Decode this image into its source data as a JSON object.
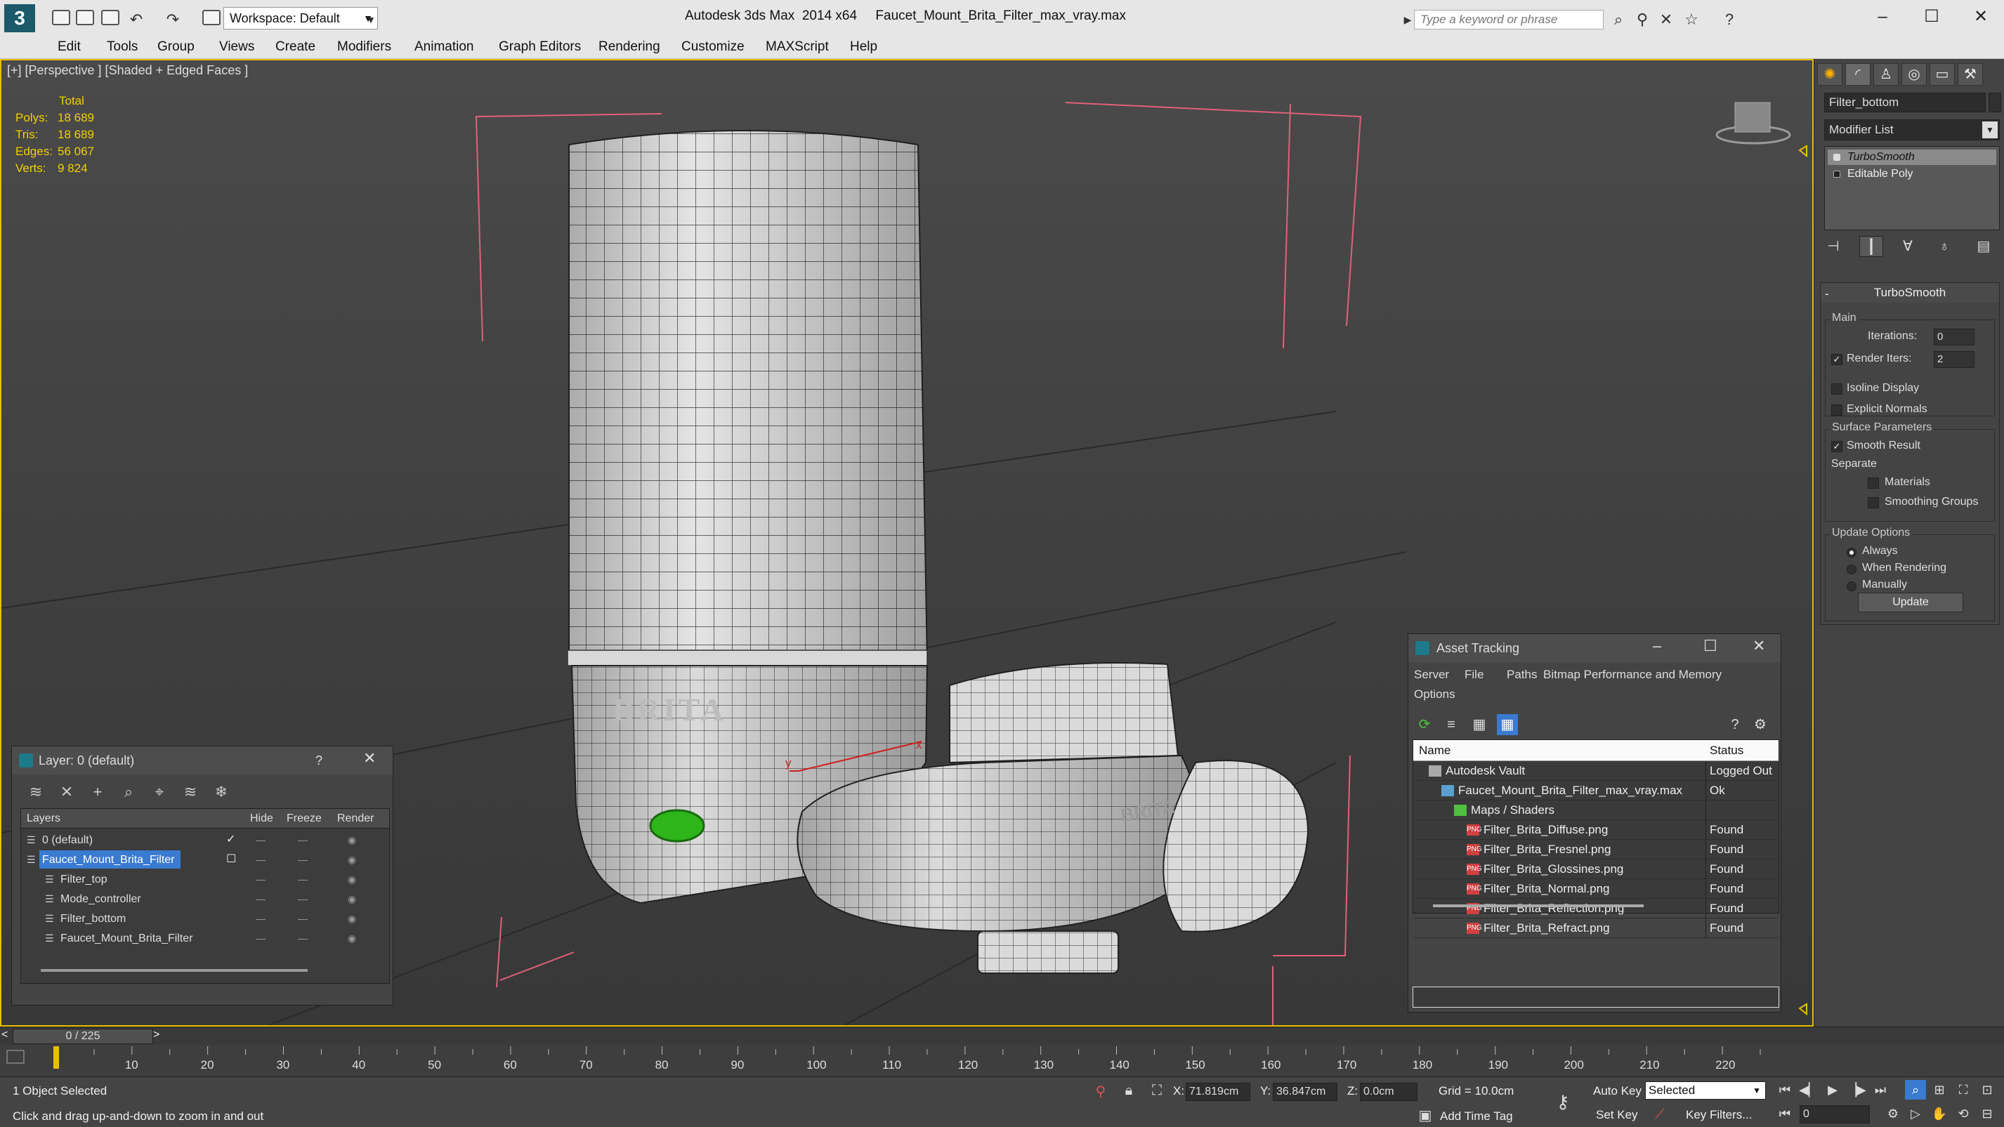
{
  "app": {
    "title": "Autodesk 3ds Max  2014 x64     Faucet_Mount_Brita_Filter_max_vray.max",
    "logo_glyph": "3",
    "workspace": "Workspace: Default",
    "search_placeholder": "Type a keyword or phrase"
  },
  "menu": [
    "Edit",
    "Tools",
    "Group",
    "Views",
    "Create",
    "Modifiers",
    "Animation",
    "Graph Editors",
    "Rendering",
    "Customize",
    "MAXScript",
    "Help"
  ],
  "viewport": {
    "label": "[+] [Perspective ] [Shaded + Edged Faces ]",
    "stats": {
      "heading": "Total",
      "rows": [
        {
          "label": "Polys:",
          "value": "18 689"
        },
        {
          "label": "Tris:",
          "value": "18 689"
        },
        {
          "label": "Edges:",
          "value": "56 067"
        },
        {
          "label": "Verts:",
          "value": "9 824"
        }
      ]
    },
    "brand_text": "BRITA",
    "accent": "#e8c000"
  },
  "command_panel": {
    "object_name": "Filter_bottom",
    "modifier_list": "Modifier List",
    "stack": [
      "TurboSmooth",
      "Editable Poly"
    ],
    "rollout": {
      "title": "TurboSmooth",
      "main_group": "Main",
      "iterations_label": "Iterations:",
      "iterations_value": "0",
      "render_iters_label": "Render Iters:",
      "render_iters_value": "2",
      "isoline": "Isoline Display",
      "explicit": "Explicit Normals",
      "surface_group": "Surface Parameters",
      "smooth_result": "Smooth Result",
      "separate": "Separate",
      "materials": "Materials",
      "smoothing_groups": "Smoothing Groups",
      "update_group": "Update Options",
      "always": "Always",
      "when_rendering": "When Rendering",
      "manually": "Manually",
      "update_btn": "Update"
    }
  },
  "layer_dialog": {
    "title": "Layer: 0 (default)",
    "help": "?",
    "columns": [
      "Layers",
      "Hide",
      "Freeze",
      "Render"
    ],
    "rows": [
      {
        "name": "0 (default)",
        "indent": 0,
        "active": true,
        "selected": false
      },
      {
        "name": "Faucet_Mount_Brita_Filter",
        "indent": 0,
        "active": false,
        "selected": true
      },
      {
        "name": "Filter_top",
        "indent": 1,
        "active": false,
        "selected": false
      },
      {
        "name": "Mode_controller",
        "indent": 1,
        "active": false,
        "selected": false
      },
      {
        "name": "Filter_bottom",
        "indent": 1,
        "active": false,
        "selected": false
      },
      {
        "name": "Faucet_Mount_Brita_Filter",
        "indent": 1,
        "active": false,
        "selected": false
      }
    ]
  },
  "asset_dialog": {
    "title": "Asset Tracking",
    "menu": [
      "Server",
      "File",
      "Paths",
      "Bitmap Performance and Memory"
    ],
    "menu2": "Options",
    "columns": [
      "Name",
      "Status"
    ],
    "rows": [
      {
        "name": "Autodesk Vault",
        "status": "Logged Out",
        "indent": 1,
        "icon": "vault-icon"
      },
      {
        "name": "Faucet_Mount_Brita_Filter_max_vray.max",
        "status": "Ok",
        "indent": 2,
        "icon": "max-file-icon"
      },
      {
        "name": "Maps / Shaders",
        "status": "",
        "indent": 3,
        "icon": "folder-icon"
      },
      {
        "name": "Filter_Brita_Diffuse.png",
        "status": "Found",
        "indent": 4,
        "icon": "png-icon"
      },
      {
        "name": "Filter_Brita_Fresnel.png",
        "status": "Found",
        "indent": 4,
        "icon": "png-icon"
      },
      {
        "name": "Filter_Brita_Glossines.png",
        "status": "Found",
        "indent": 4,
        "icon": "png-icon"
      },
      {
        "name": "Filter_Brita_Normal.png",
        "status": "Found",
        "indent": 4,
        "icon": "png-icon"
      },
      {
        "name": "Filter_Brita_Reflection.png",
        "status": "Found",
        "indent": 4,
        "icon": "png-icon"
      },
      {
        "name": "Filter_Brita_Refract.png",
        "status": "Found",
        "indent": 4,
        "icon": "png-icon"
      }
    ]
  },
  "timeline": {
    "frame": "0 / 225",
    "ticks": [
      0,
      10,
      20,
      30,
      40,
      50,
      60,
      70,
      80,
      90,
      100,
      110,
      120,
      130,
      140,
      150,
      160,
      170,
      180,
      190,
      200,
      210,
      220
    ],
    "max_frame": 225
  },
  "status": {
    "selected": "1 Object Selected",
    "prompt": "Click and drag up-and-down to zoom in and out",
    "x_label": "X:",
    "x": "71.819cm",
    "y_label": "Y:",
    "y": "36.847cm",
    "z_label": "Z:",
    "z": "0.0cm",
    "grid": "Grid = 10.0cm",
    "auto_key": "Auto Key",
    "set_key": "Set Key",
    "key_mode": "Selected",
    "key_filters": "Key Filters...",
    "add_time_tag": "Add Time Tag",
    "frame_field": "0"
  }
}
